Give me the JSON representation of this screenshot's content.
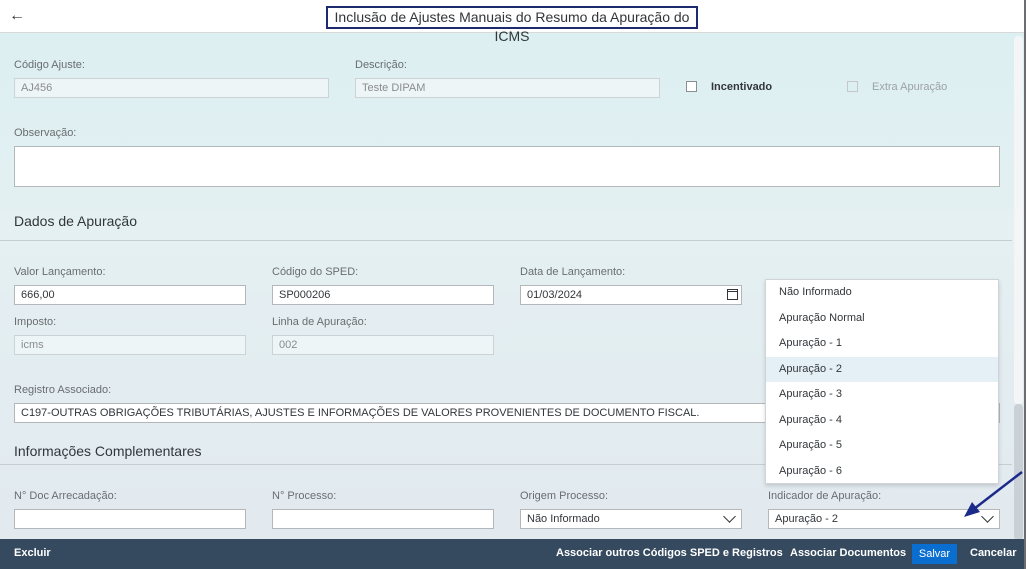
{
  "header": {
    "title": "Inclusão de Ajustes Manuais do Resumo da Apuração do ICMS",
    "back_icon": "arrow-left-icon"
  },
  "form": {
    "codigo_ajuste": {
      "label": "Código Ajuste:",
      "value": "AJ456"
    },
    "descricao": {
      "label": "Descrição:",
      "value": "Teste DIPAM"
    },
    "incentivado": {
      "label": "Incentivado",
      "checked": false
    },
    "extra_apuracao": {
      "label": "Extra Apuração",
      "checked": false,
      "disabled": true
    },
    "observacao": {
      "label": "Observação:",
      "value": ""
    }
  },
  "dados_apuracao": {
    "title": "Dados de Apuração",
    "valor_lancamento": {
      "label": "Valor Lançamento:",
      "value": "666,00"
    },
    "codigo_sped": {
      "label": "Código do SPED:",
      "value": "SP000206"
    },
    "data_lancamento": {
      "label": "Data de Lançamento:",
      "value": "01/03/2024"
    },
    "imposto": {
      "label": "Imposto:",
      "value": "icms"
    },
    "linha_apuracao": {
      "label": "Linha de Apuração:",
      "value": "002"
    },
    "registro_associado": {
      "label": "Registro Associado:",
      "value": "C197-OUTRAS OBRIGAÇÕES TRIBUTÁRIAS, AJUSTES E INFORMAÇÕES DE VALORES PROVENIENTES DE DOCUMENTO FISCAL."
    }
  },
  "info_complementares": {
    "title": "Informações Complementares",
    "doc_arrecadacao": {
      "label": "N° Doc Arrecadação:",
      "value": ""
    },
    "processo": {
      "label": "N° Processo:",
      "value": ""
    },
    "origem_processo": {
      "label": "Origem Processo:",
      "value": "Não Informado"
    },
    "indicador_apuracao": {
      "label": "Indicador de Apuração:",
      "value": "Apuração - 2"
    }
  },
  "dropdown": {
    "options": [
      "Não Informado",
      "Apuração Normal",
      "Apuração - 1",
      "Apuração - 2",
      "Apuração - 3",
      "Apuração - 4",
      "Apuração - 5",
      "Apuração - 6"
    ],
    "highlighted": "Apuração - 2"
  },
  "footer": {
    "excluir": "Excluir",
    "associar_sped": "Associar outros Códigos SPED e Registros",
    "associar_docs": "Associar Documentos",
    "salvar": "Salvar",
    "cancelar": "Cancelar"
  },
  "colors": {
    "footer_bg": "#354a5f",
    "save_button": "#0a6ed1",
    "annotation_arrow": "#1c2a8a"
  }
}
